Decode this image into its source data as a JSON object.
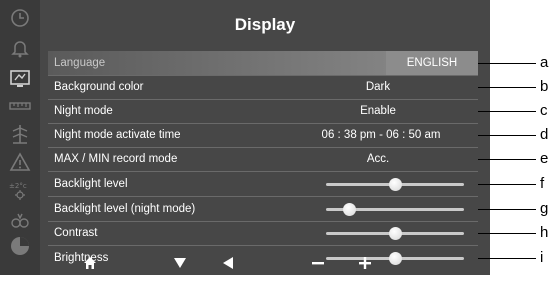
{
  "title": "Display",
  "sidebar": {
    "icons": [
      "clock-icon",
      "alarm-bell-icon",
      "display-settings-icon",
      "ruler-icon",
      "weather-station-icon",
      "warning-icon",
      "temperature-unit-icon",
      "sensor-icon",
      "pie-chart-icon"
    ]
  },
  "rows": [
    {
      "label": "Language",
      "value": "ENGLISH"
    },
    {
      "label": "Background color",
      "value": "Dark"
    },
    {
      "label": "Night mode",
      "value": "Enable"
    },
    {
      "label": "Night mode activate time",
      "value": "06 : 38 pm - 06 : 50 am"
    },
    {
      "label": "MAX / MIN record mode",
      "value": "Acc."
    },
    {
      "label": "Backlight level",
      "level": 0.5
    },
    {
      "label": "Backlight level (night mode)",
      "level": 0.17
    },
    {
      "label": "Contrast",
      "level": 0.5
    },
    {
      "label": "Brightness",
      "level": 0.5
    }
  ],
  "footer": {
    "buttons": [
      "home-icon",
      "down-arrow-icon",
      "left-arrow-icon",
      "minus-icon",
      "plus-icon"
    ]
  },
  "callouts": [
    "a",
    "b",
    "c",
    "d",
    "e",
    "f",
    "g",
    "h",
    "i"
  ],
  "colors": {
    "screen_bg": "#474747",
    "sidebar_bg": "#3a3a3a",
    "icon_gray": "#7a7a7a",
    "highlight": "#8c8c8c"
  }
}
